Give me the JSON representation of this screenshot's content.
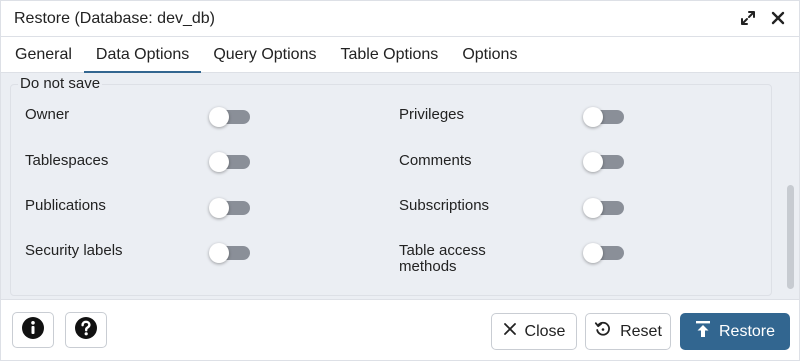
{
  "dialog": {
    "title": "Restore (Database: dev_db)"
  },
  "tabs": [
    {
      "label": "General"
    },
    {
      "label": "Data Options"
    },
    {
      "label": "Query Options"
    },
    {
      "label": "Table Options"
    },
    {
      "label": "Options"
    }
  ],
  "active_tab": "Data Options",
  "section": {
    "legend": "Do not save",
    "options": [
      {
        "label": "Owner",
        "enabled": false
      },
      {
        "label": "Privileges",
        "enabled": false
      },
      {
        "label": "Tablespaces",
        "enabled": false
      },
      {
        "label": "Comments",
        "enabled": false
      },
      {
        "label": "Publications",
        "enabled": false
      },
      {
        "label": "Subscriptions",
        "enabled": false
      },
      {
        "label": "Security labels",
        "enabled": false
      },
      {
        "label": "Table access methods",
        "enabled": false
      }
    ]
  },
  "footer": {
    "info_icon": "info-icon",
    "help_icon": "help-icon",
    "close_label": "Close",
    "reset_label": "Reset",
    "restore_label": "Restore"
  },
  "colors": {
    "accent": "#326690",
    "toggle_off_track": "#8a8f98",
    "panel_background": "#ebeef3"
  }
}
